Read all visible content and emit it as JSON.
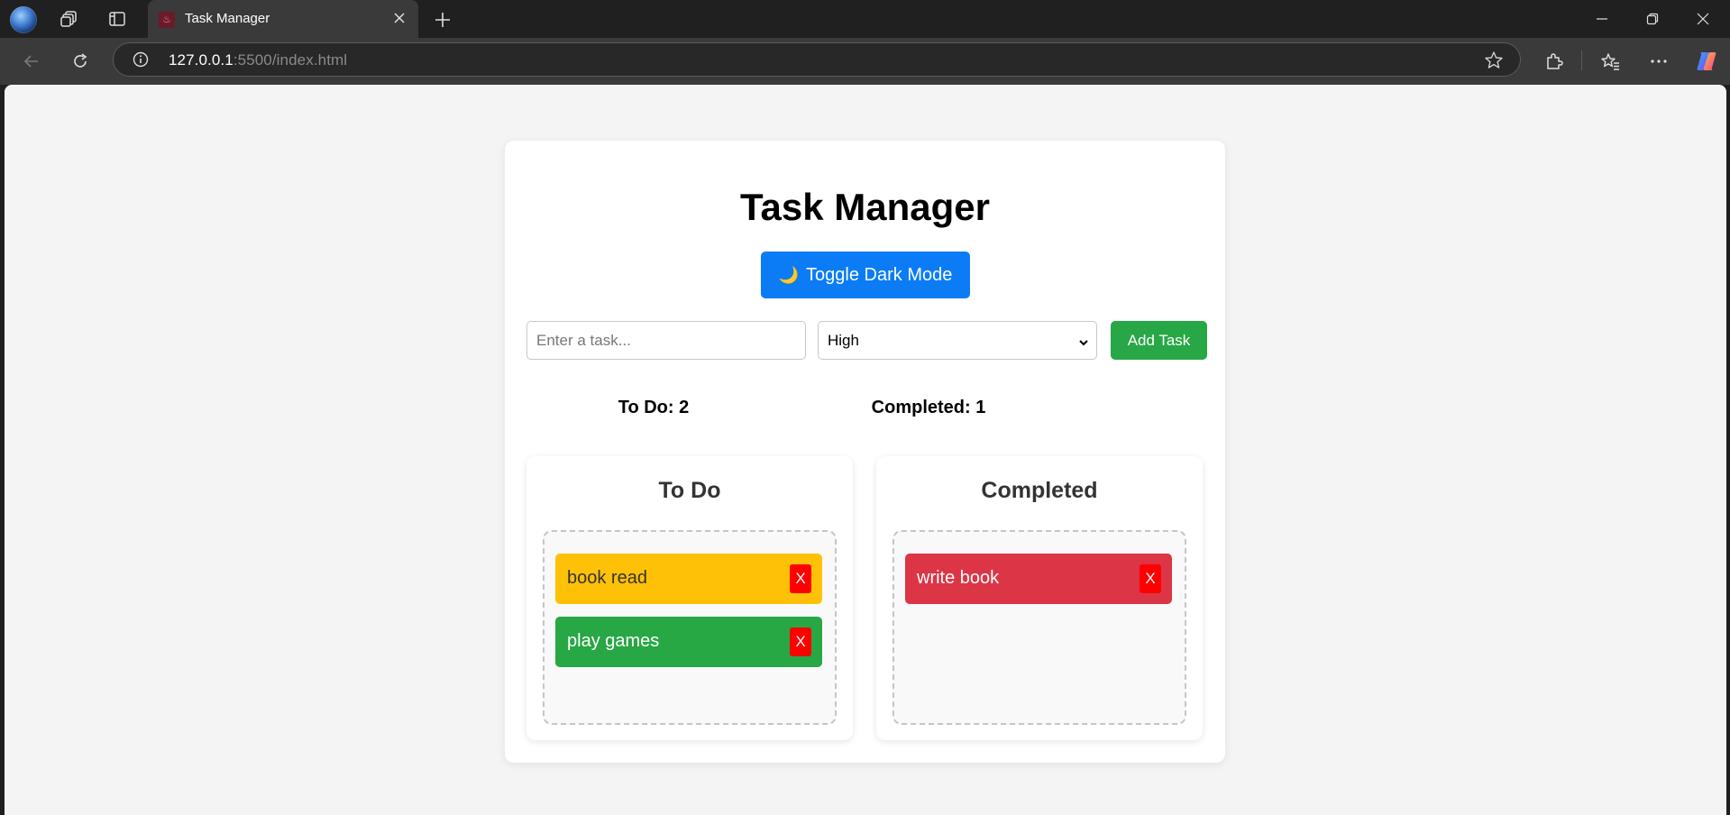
{
  "browser": {
    "tab_title": "Task Manager",
    "url_host": "127.0.0.1",
    "url_rest": ":5500/index.html"
  },
  "app": {
    "title": "Task Manager",
    "toggle_label": "Toggle Dark Mode",
    "toggle_icon": "🌙",
    "input_placeholder": "Enter a task...",
    "priority_selected": "High",
    "add_label": "Add Task"
  },
  "stats": {
    "todo": "To Do: 2",
    "completed": "Completed: 1"
  },
  "columns": {
    "todo": {
      "title": "To Do",
      "tasks": [
        {
          "text": "book read",
          "color": "#ffc107",
          "text_color": "#333333",
          "delete_label": "X"
        },
        {
          "text": "play games",
          "color": "#28a745",
          "text_color": "#ffffff",
          "delete_label": "X"
        }
      ]
    },
    "completed": {
      "title": "Completed",
      "tasks": [
        {
          "text": "write book",
          "color": "#dc3545",
          "text_color": "#ffffff",
          "delete_label": "X"
        }
      ]
    }
  },
  "colors": {
    "accent_blue": "#0b7cf5",
    "add_green": "#27a745",
    "delete_red": "#ff0000"
  }
}
